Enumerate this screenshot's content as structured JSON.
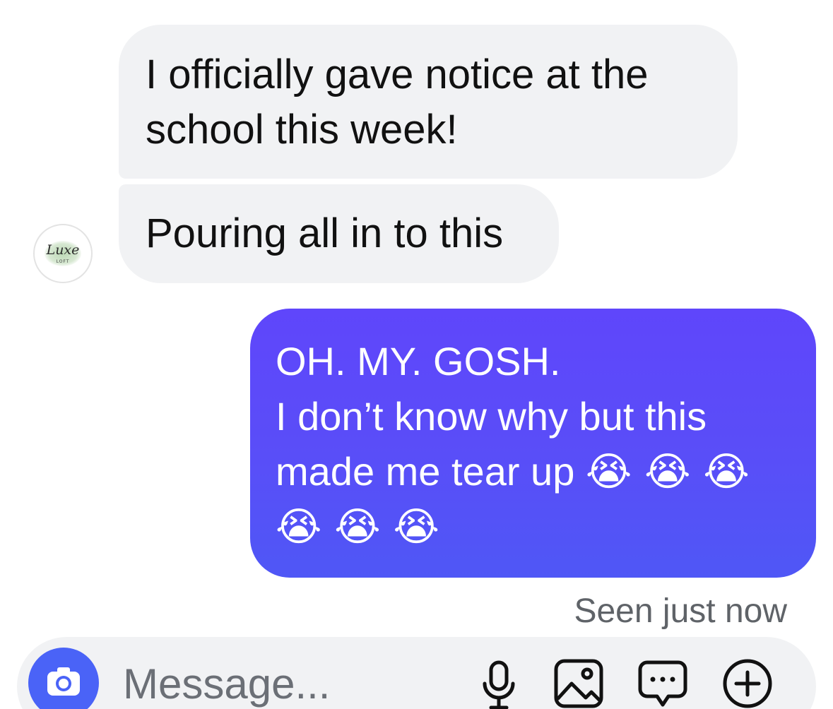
{
  "conversation": {
    "incoming": [
      {
        "lines": [
          "I officially gave notice at the",
          "school this week!"
        ]
      },
      {
        "lines": [
          "Pouring all in to this"
        ]
      }
    ],
    "avatar": {
      "script": "Luxe",
      "sub": "LOFT"
    },
    "outgoing": {
      "lines": [
        "OH. MY. GOSH.",
        "I don’t know why but this",
        "made me tear up"
      ],
      "emoji_row_inline": "😭 😭 😭",
      "emoji_row": "😭 😭 😭"
    },
    "status": "Seen just now"
  },
  "composer": {
    "placeholder": "Message..."
  },
  "icons": [
    "camera-icon",
    "microphone-icon",
    "gallery-icon",
    "sticker-icon",
    "plus-icon"
  ],
  "colors": {
    "incoming_bubble": "#f1f2f4",
    "outgoing_top": "#5f46fb",
    "outgoing_bottom": "#4f57f6",
    "camera_button": "#4a63f7"
  }
}
